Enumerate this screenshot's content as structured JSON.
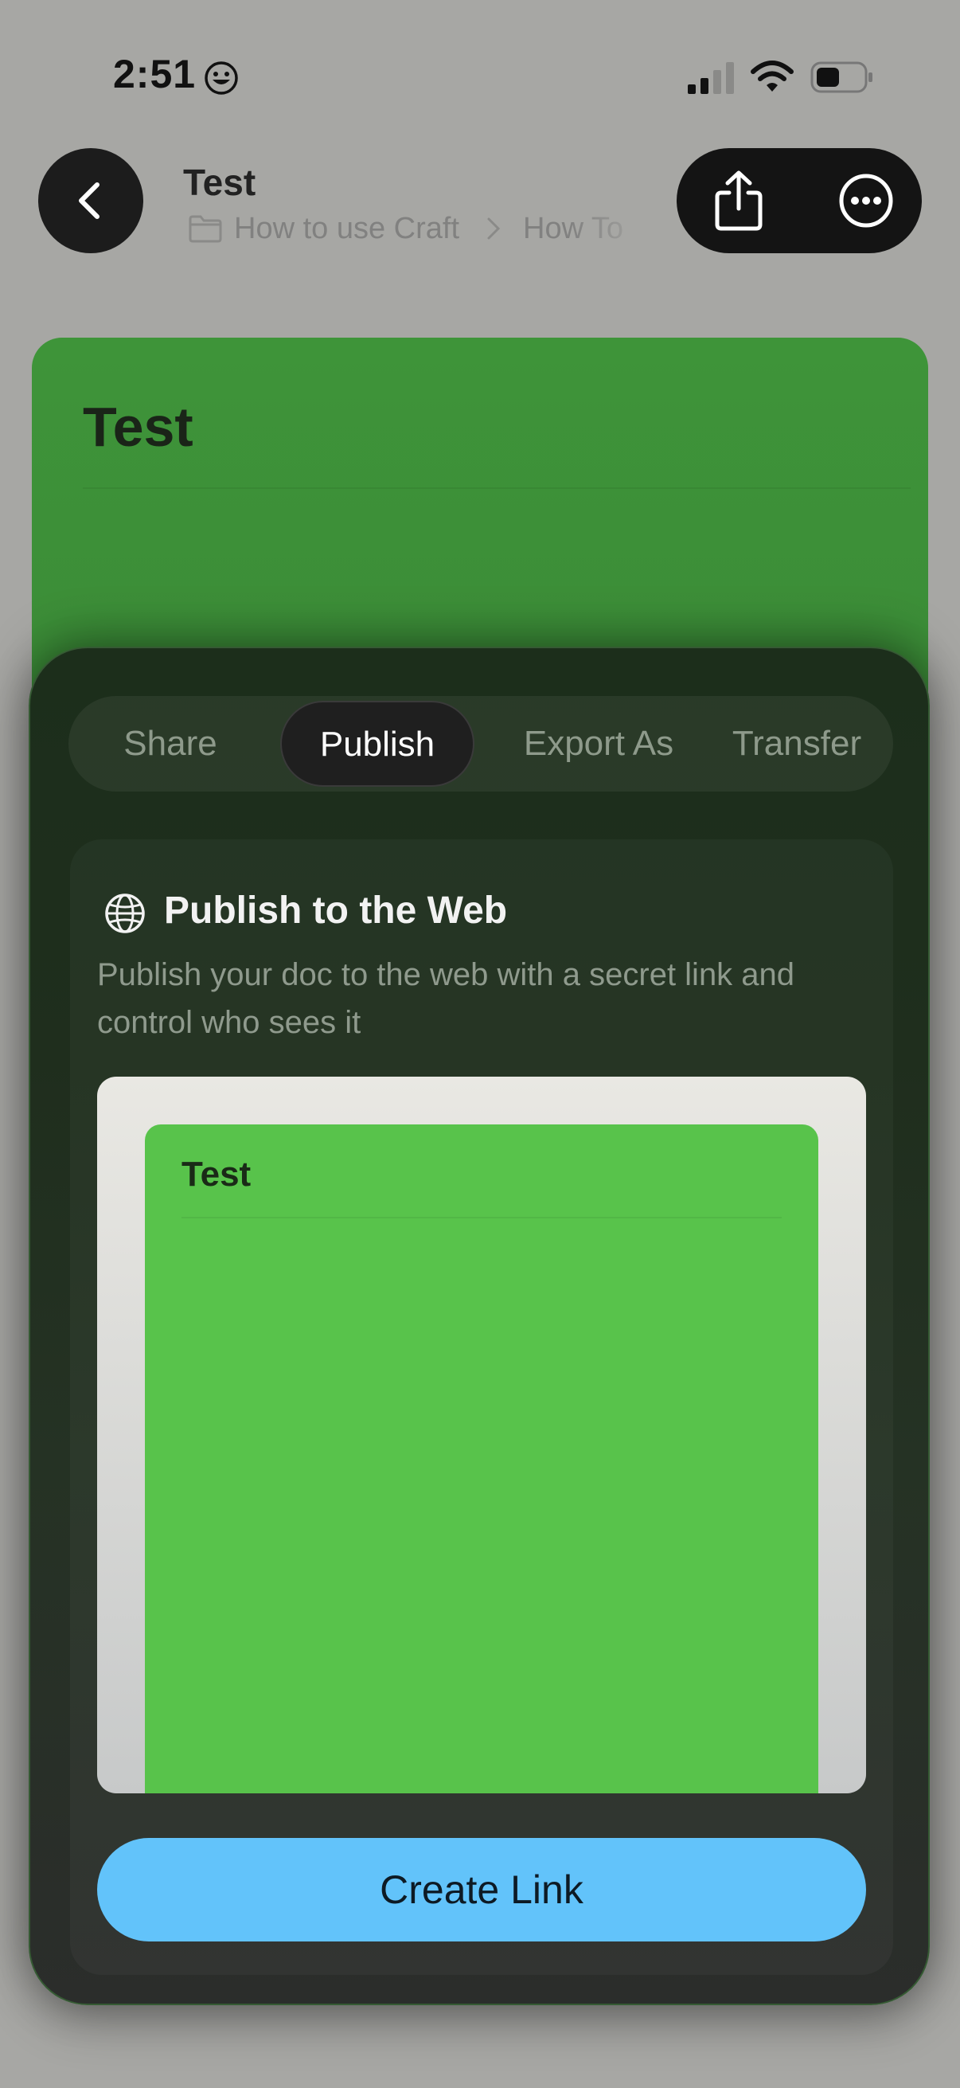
{
  "status_bar": {
    "time": "2:51"
  },
  "nav": {
    "title": "Test",
    "breadcrumb": {
      "folder": "How to use Craft",
      "subfolder": "How To"
    },
    "icons": [
      "chevron-left-icon",
      "share-icon",
      "more-icon"
    ]
  },
  "document": {
    "title": "Test",
    "card_color": "#3c8d38"
  },
  "sheet": {
    "tabs": [
      "Share",
      "Publish",
      "Export As",
      "Transfer"
    ],
    "active_tab": "Publish",
    "panel": {
      "icon": "globe-icon",
      "title": "Publish to the Web",
      "description": "Publish your doc to the web with a secret link and control who sees it",
      "preview_title": "Test",
      "preview_color": "#58c34b",
      "button_label": "Create Link",
      "button_color": "#62c3fa"
    }
  }
}
